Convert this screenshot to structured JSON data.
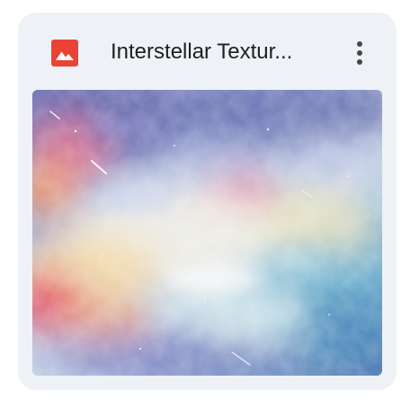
{
  "file_card": {
    "title": "Interstellar Textur...",
    "file_type_icon": "image-file-icon",
    "more_icon": "more-vertical-icon",
    "thumbnail_description_icon": "watercolor-nebula-thumbnail",
    "colors": {
      "card_background": "#eef1f6",
      "image_icon_red": "#ea4335",
      "title_text": "#1f1f1f",
      "more_icon": "#444746"
    }
  }
}
